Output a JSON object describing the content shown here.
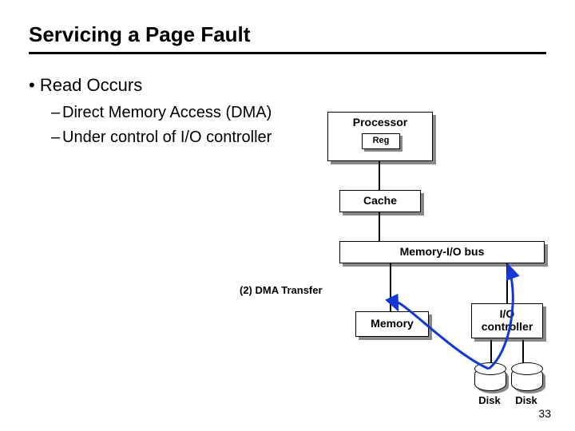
{
  "title": "Servicing a Page Fault",
  "bullets": {
    "b1": "Read Occurs",
    "b2a": "Direct Memory Access (DMA)",
    "b2b": "Under control of I/O controller"
  },
  "diagram": {
    "processor": "Processor",
    "reg": "Reg",
    "cache": "Cache",
    "bus": "Memory-I/O bus",
    "memory": "Memory",
    "ioc_l1": "I/O",
    "ioc_l2": "controller",
    "disk": "Disk",
    "dma_label": "(2) DMA Transfer"
  },
  "slide_number": "33"
}
